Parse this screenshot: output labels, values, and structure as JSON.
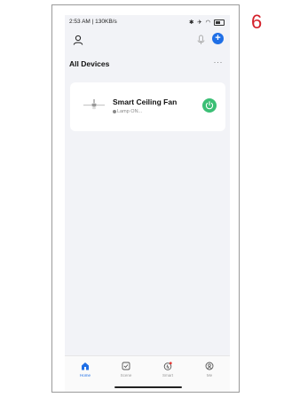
{
  "page_number": "6",
  "status_bar": {
    "time_speed": "2:53 AM | 130KB/s",
    "icons": [
      "bluetooth-icon",
      "airplane-icon",
      "wifi-icon",
      "battery-icon"
    ]
  },
  "header": {
    "profile_icon": "person-icon",
    "mic_icon": "microphone-icon",
    "add_label": "+"
  },
  "section": {
    "title": "All Devices",
    "more_label": "···"
  },
  "devices": [
    {
      "name": "Smart Ceiling Fan",
      "status": "Lamp ON...",
      "power_color": "#3bbf75"
    }
  ],
  "tabs": [
    {
      "label": "Home",
      "icon": "home-icon",
      "active": true
    },
    {
      "label": "Scene",
      "icon": "scene-icon",
      "active": false
    },
    {
      "label": "Smart",
      "icon": "smart-icon",
      "active": false
    },
    {
      "label": "Me",
      "icon": "me-icon",
      "active": false
    }
  ],
  "colors": {
    "accent": "#1f6fe6",
    "power_on": "#3bbf75",
    "page_number": "#d4202a",
    "background": "#f2f3f7"
  }
}
